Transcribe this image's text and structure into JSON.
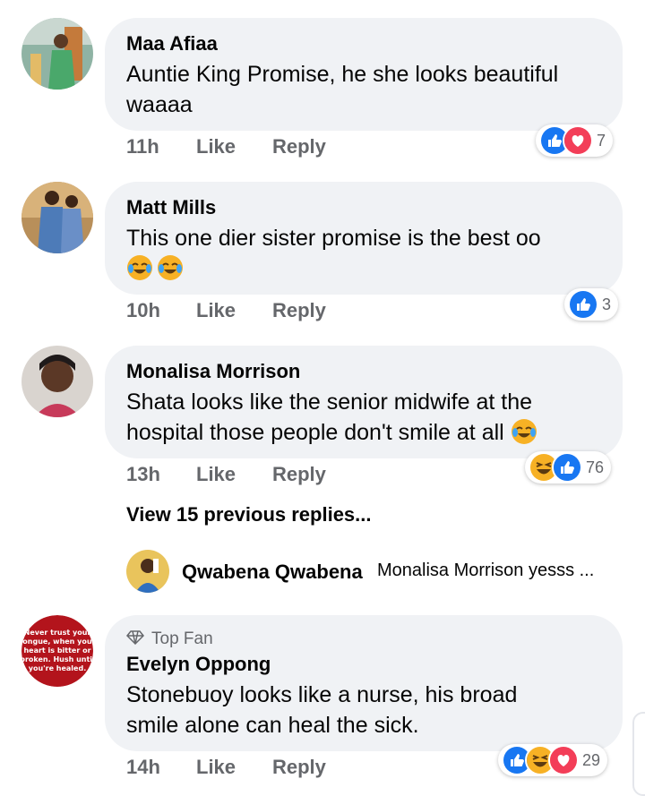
{
  "comments": [
    {
      "author": "Maa Afiaa",
      "line1": "Auntie King Promise, he she looks beautiful",
      "line2": "waaaa",
      "time": "11h",
      "like_label": "Like",
      "reply_label": "Reply",
      "reaction_count": "7",
      "reactions": [
        "like-icon",
        "love-icon"
      ]
    },
    {
      "author": "Matt Mills",
      "line1": "This one dier sister promise is the best oo",
      "line2_emoji": [
        "tears-of-joy-emoji",
        "tears-of-joy-emoji"
      ],
      "time": "10h",
      "like_label": "Like",
      "reply_label": "Reply",
      "reaction_count": "3",
      "reactions": [
        "like-icon"
      ]
    },
    {
      "author": "Monalisa Morrison",
      "line1": "Shata looks like the senior midwife at the",
      "line2": "hospital those people don't smile at all",
      "line2_emoji": [
        "tears-of-joy-emoji"
      ],
      "time": "13h",
      "like_label": "Like",
      "reply_label": "Reply",
      "reaction_count": "76",
      "reactions": [
        "haha-icon",
        "like-icon"
      ]
    },
    {
      "badge": "Top Fan",
      "author": "Evelyn Oppong",
      "line1": "Stonebuoy looks like a nurse, his broad",
      "line2": "smile alone can heal the sick.",
      "time": "14h",
      "like_label": "Like",
      "reply_label": "Reply",
      "reaction_count": "29",
      "reactions": [
        "like-icon",
        "haha-icon",
        "love-icon"
      ],
      "avatar_text": [
        "Never trust your",
        "tongue, when your",
        "heart is bitter or",
        "broken. Hush until",
        "you're healed."
      ]
    }
  ],
  "view_replies_label": "View 15 previous replies...",
  "reply_preview": {
    "author": "Qwabena Qwabena",
    "text": "Monalisa Morrison yesss ..."
  },
  "colors": {
    "bubble": "#f0f2f5",
    "secondary_text": "#65676b",
    "like_blue": "#1877f2",
    "love_red": "#f33e58",
    "haha_yellow": "#f7b125"
  }
}
